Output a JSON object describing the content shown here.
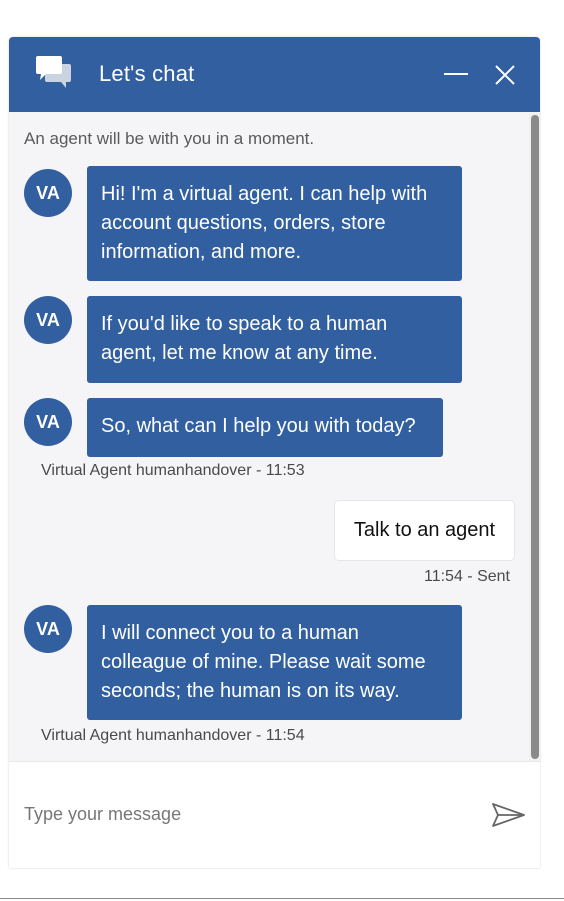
{
  "header": {
    "title": "Let's chat",
    "chat_icon": "chat-bubbles-icon",
    "minimize_icon": "minimize-icon",
    "close_icon": "close-icon"
  },
  "messages": {
    "notice": "An agent will be with you in a moment.",
    "bot_initials": "VA",
    "bot_1": [
      "Hi! I'm a virtual agent. I can help with",
      "account questions, orders, store",
      "information, and more."
    ],
    "bot_2": [
      "If you'd like to speak to a human",
      "agent, let me know at any time."
    ],
    "bot_3": "So, what can I help you with today?",
    "meta_1": "Virtual Agent humanhandover - 11:53",
    "user_1": "Talk to an agent",
    "user_meta_1": "11:54 - Sent",
    "bot_4": [
      "I will connect you to a human",
      "colleague of mine. Please wait some",
      "seconds; the human is on its way."
    ],
    "meta_2": "Virtual Agent humanhandover - 11:54"
  },
  "composer": {
    "placeholder": "Type your message",
    "send_icon": "send-icon"
  },
  "colors": {
    "brand": "#315fa0",
    "background": "#f5f5f7",
    "bubble_user": "#ffffff"
  }
}
